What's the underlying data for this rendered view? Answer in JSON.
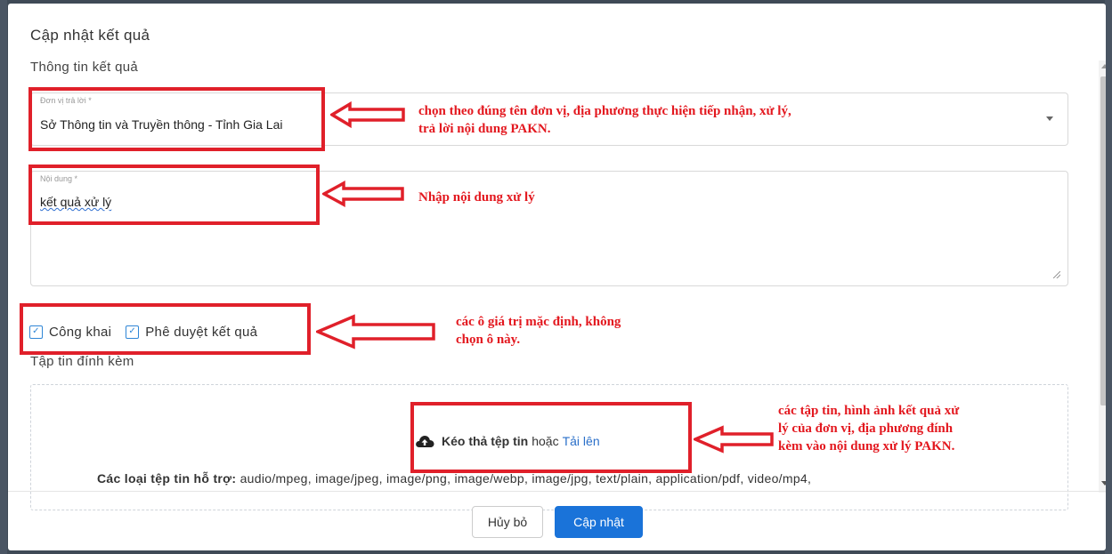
{
  "dialog": {
    "title": "Cập nhật kết quả",
    "section_label": "Thông tin kết quả",
    "unit_field": {
      "label": "Đơn vị trả lời *",
      "value": "Sở Thông tin và Truyền thông - Tỉnh Gia Lai"
    },
    "content_field": {
      "label": "Nội dung *",
      "value": "kết quả xử lý"
    },
    "checkboxes": [
      {
        "label": "Công khai",
        "checked": true
      },
      {
        "label": "Phê duyệt kết quả",
        "checked": true
      }
    ],
    "attachments": {
      "label": "Tập tin đính kèm",
      "drop_text": "Kéo thả tệp tin",
      "or_text": "hoặc",
      "upload_link": "Tải lên",
      "supported_label": "Các loại tệp tin hỗ trợ:",
      "supported_types": "audio/mpeg, image/jpeg, image/png, image/webp, image/jpg, text/plain, application/pdf, video/mp4,"
    },
    "buttons": {
      "cancel": "Hủy bỏ",
      "submit": "Cập nhật"
    }
  },
  "annotations": {
    "unit_note": [
      "chọn theo đúng tên đơn vị, địa phương thực hiện tiếp nhận, xử lý,",
      "trả lời nội dung PAKN."
    ],
    "content_note": "Nhập nội dung xử lý",
    "checkbox_note": [
      "các ô giá trị mặc định, không",
      "chọn ô này."
    ],
    "attach_note": [
      "các tập tin, hình ảnh kết quả xử",
      "lý của đơn vị, địa phương đính",
      "kèm vào nội dung xử lý PAKN."
    ]
  },
  "colors": {
    "accent": "#1a73d9",
    "annotation": "#e0202a",
    "link": "#2a6fc9"
  },
  "icons": [
    "cloud-upload-icon",
    "check-icon",
    "chevron-down-icon",
    "arrow-left-icon"
  ]
}
